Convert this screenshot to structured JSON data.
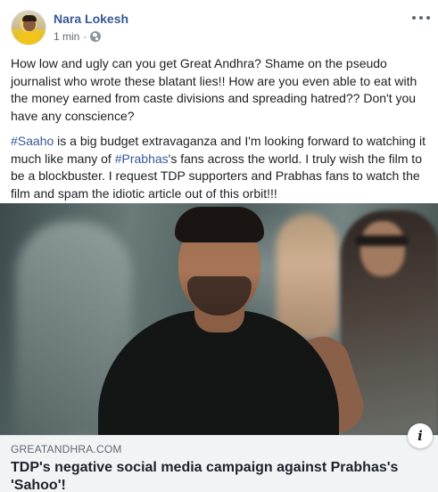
{
  "post": {
    "author": "Nara Lokesh",
    "time": "1 min",
    "separator": "·",
    "privacy_icon": "globe-icon",
    "more_icon": "more-options-icon",
    "paragraph1": "How low and ugly can you get Great Andhra? Shame on the pseudo journalist who wrote these blatant lies!! How are you even able to eat with the money earned from caste divisions and spreading hatred?? Don't you have any conscience?",
    "hashtag1": "#Saaho",
    "paragraph2_a": " is a big budget extravaganza and I'm looking forward to watching it much like many of ",
    "hashtag2": "#Prabhas",
    "paragraph2_b": "'s fans across the world. I truly wish the film to be a blockbuster. I request TDP supporters and Prabhas fans to watch the film and spam the idiotic article out of this orbit!!!"
  },
  "link": {
    "domain": "GREATANDHRA.COM",
    "title": "TDP's negative social media campaign against Prabhas's 'Sahoo'!",
    "info_label": "i"
  },
  "colors": {
    "author": "#385898",
    "hashtag": "#365899",
    "link_footer_bg": "#f2f3f5"
  }
}
